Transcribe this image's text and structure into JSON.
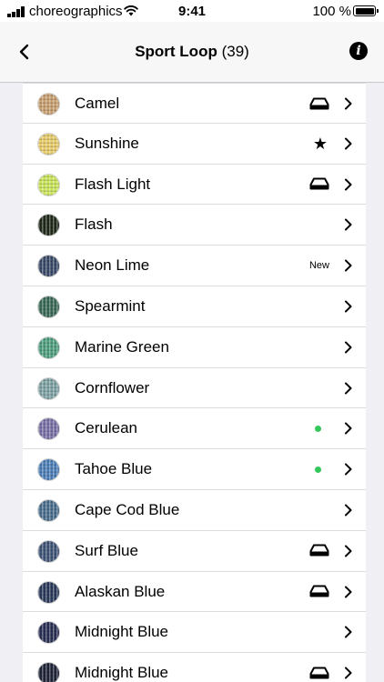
{
  "status_bar": {
    "carrier": "choreographics",
    "time": "9:41",
    "battery_percent": "100 %",
    "icons": [
      "signal-icon",
      "wifi-icon",
      "battery-icon"
    ]
  },
  "nav": {
    "title": "Sport Loop",
    "count": "(39)",
    "icons": [
      "back-chevron-icon",
      "info-icon"
    ]
  },
  "bands": [
    {
      "name": "Camel",
      "accessory": "owned",
      "color": "#c9a070"
    },
    {
      "name": "Sunshine",
      "accessory": "favorite",
      "color": "#e8cd6a"
    },
    {
      "name": "Flash Light",
      "accessory": "owned",
      "color": "#cbe65a"
    },
    {
      "name": "Flash",
      "accessory": "none",
      "color": "#1f2a1a"
    },
    {
      "name": "Neon Lime",
      "accessory": "new",
      "accessory_label": "New",
      "color": "#3a4a6a"
    },
    {
      "name": "Spearmint",
      "accessory": "none",
      "color": "#3a6b58"
    },
    {
      "name": "Marine Green",
      "accessory": "none",
      "color": "#4fa07f"
    },
    {
      "name": "Cornflower",
      "accessory": "none",
      "color": "#7fa2a5"
    },
    {
      "name": "Cerulean",
      "accessory": "dot",
      "color": "#7a72a8"
    },
    {
      "name": "Tahoe Blue",
      "accessory": "dot",
      "color": "#4d80b8"
    },
    {
      "name": "Cape Cod Blue",
      "accessory": "none",
      "color": "#4a6f8f"
    },
    {
      "name": "Surf Blue",
      "accessory": "owned",
      "color": "#3f5578"
    },
    {
      "name": "Alaskan Blue",
      "accessory": "owned",
      "color": "#2b3a5c"
    },
    {
      "name": "Midnight Blue",
      "accessory": "none",
      "color": "#2a2f55"
    },
    {
      "name": "Midnight Blue",
      "accessory": "owned",
      "color": "#1f2438"
    }
  ],
  "colors": {
    "background": "#efeff4",
    "cell": "#ffffff",
    "separator": "#dcdce0",
    "dot": "#34c759"
  }
}
